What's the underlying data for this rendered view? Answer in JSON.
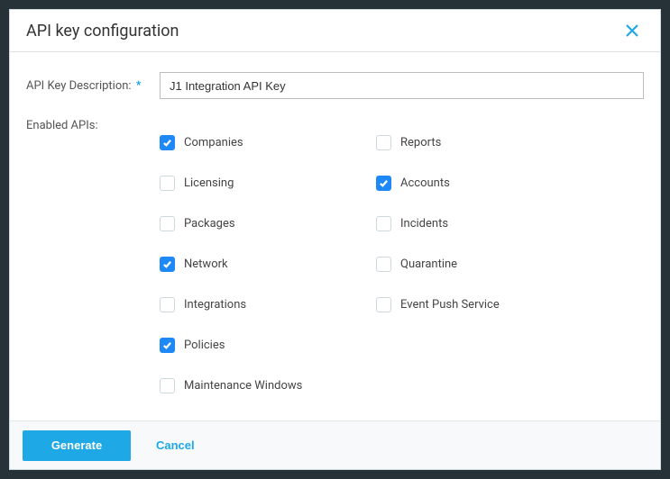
{
  "dialog": {
    "title": "API key configuration"
  },
  "form": {
    "description_label": "API Key Description:",
    "description_value": "J1 Integration API Key",
    "enabled_apis_label": "Enabled APIs:"
  },
  "apis": {
    "companies": {
      "label": "Companies",
      "checked": true
    },
    "reports": {
      "label": "Reports",
      "checked": false
    },
    "licensing": {
      "label": "Licensing",
      "checked": false
    },
    "accounts": {
      "label": "Accounts",
      "checked": true
    },
    "packages": {
      "label": "Packages",
      "checked": false
    },
    "incidents": {
      "label": "Incidents",
      "checked": false
    },
    "network": {
      "label": "Network",
      "checked": true
    },
    "quarantine": {
      "label": "Quarantine",
      "checked": false
    },
    "integrations": {
      "label": "Integrations",
      "checked": false
    },
    "eventpush": {
      "label": "Event Push Service",
      "checked": false
    },
    "policies": {
      "label": "Policies",
      "checked": true
    },
    "maintenance": {
      "label": "Maintenance Windows",
      "checked": false
    }
  },
  "footer": {
    "generate": "Generate",
    "cancel": "Cancel"
  }
}
